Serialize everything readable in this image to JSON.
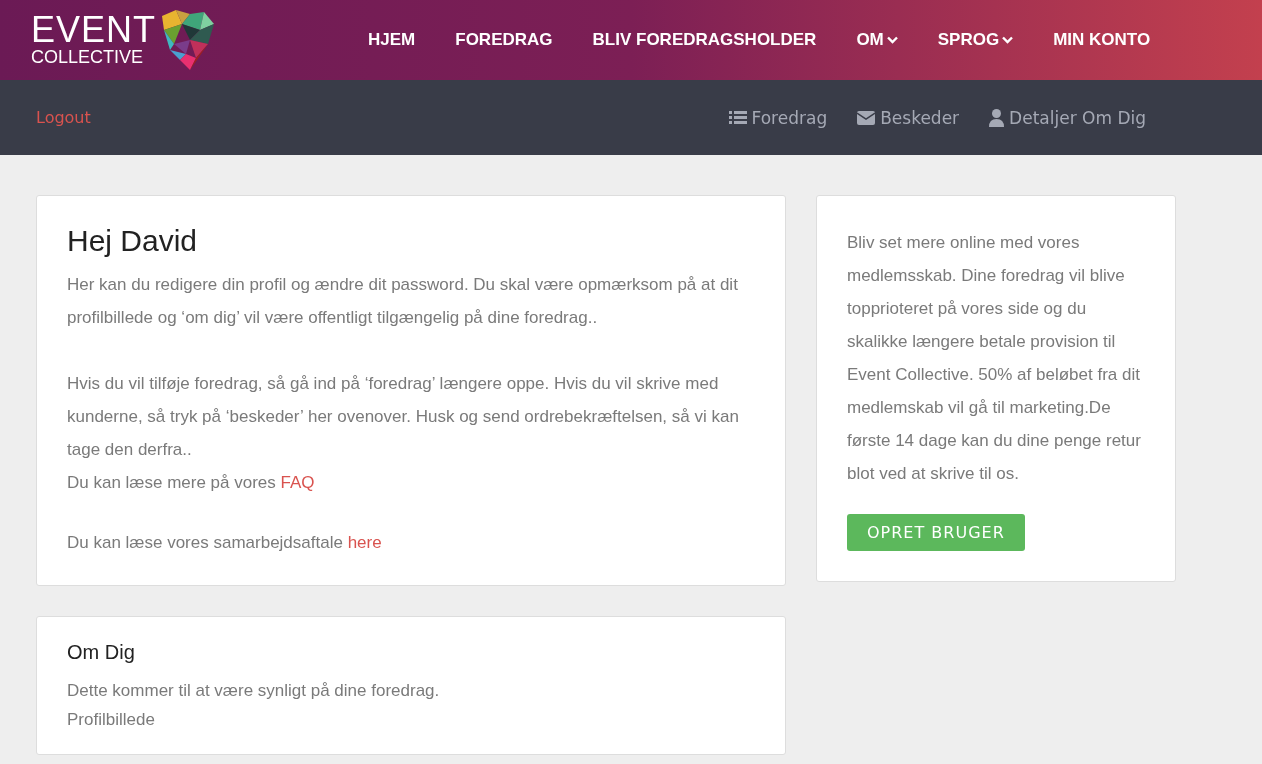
{
  "logo": {
    "line_1": "EVENT",
    "line_2": "COLLECTIVE"
  },
  "nav": [
    {
      "label": "HJEM",
      "dropdown": false
    },
    {
      "label": "FOREDRAG",
      "dropdown": false
    },
    {
      "label": "BLIV FOREDRAGSHOLDER",
      "dropdown": false
    },
    {
      "label": "OM",
      "dropdown": true
    },
    {
      "label": "SPROG",
      "dropdown": true
    },
    {
      "label": "MIN KONTO",
      "dropdown": false
    }
  ],
  "subnav": {
    "logout": "Logout",
    "links": [
      {
        "kind": "list",
        "label": "Foredrag"
      },
      {
        "kind": "mail",
        "label": "Beskeder"
      },
      {
        "kind": "user",
        "label": "Detaljer Om Dig"
      }
    ]
  },
  "welcome": {
    "title": "Hej David",
    "paragraphs": [
      "Her kan du redigere din profil og ændre dit password. Du skal være opmærksom på at dit profilbillede og ‘om dig’ vil være offentligt tilgængelig på dine foredrag..",
      "Hvis du vil tilføje foredrag, så gå ind på ‘foredrag’ længere oppe. Hvis du vil skrive med kunderne, så tryk på ‘beskeder’ her ovenover. Husk og send ordrebekræftelsen, så vi kan tage den derfra.."
    ],
    "faq_line": {
      "text": "Du kan læse mere på vores",
      "link": "FAQ"
    },
    "agreement_line": {
      "text": "Du kan læse vores samarbejdsaftale",
      "link": "here"
    }
  },
  "about": {
    "title": "Om Dig",
    "lines": [
      "Dette kommer til at være synligt på dine foredrag.",
      "Profilbillede"
    ]
  },
  "membership": {
    "text": "Bliv set mere online med vores medlemsskab. Dine foredrag vil blive topprioteret på vores side og du skalikke længere betale provision til Event Collective. 50% af beløbet fra dit medlemskab vil gå til marketing.De første 14 dage kan du dine penge retur blot ved at skrive til os.",
    "button": "OPRET BRUGER"
  }
}
